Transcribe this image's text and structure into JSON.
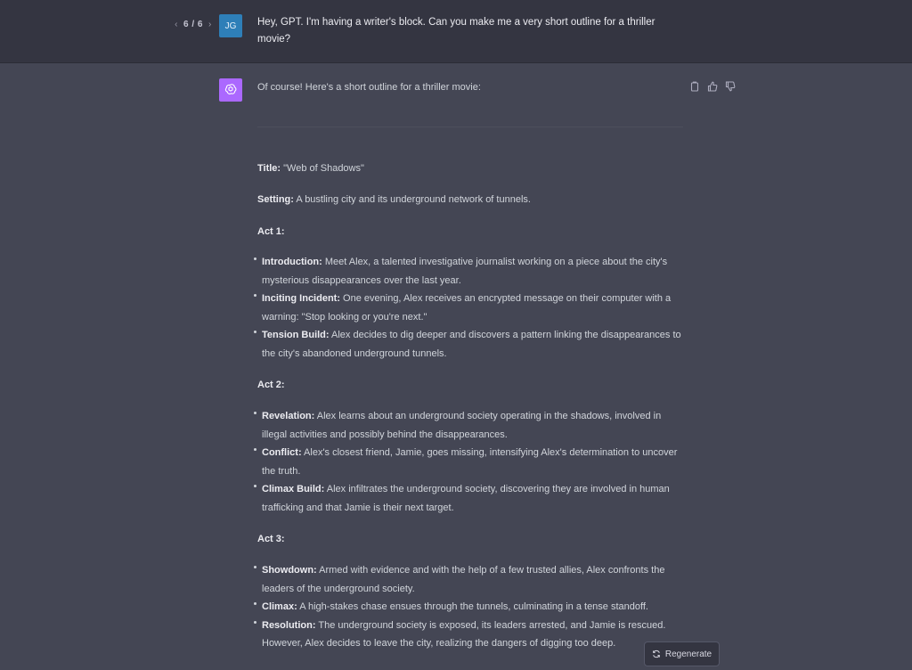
{
  "user_message": {
    "pager": {
      "prev_icon": "‹",
      "count": "6 / 6",
      "next_icon": "›"
    },
    "avatar": "JG",
    "text": "Hey, GPT. I'm having a writer's block. Can you make me a very short outline for a thriller movie?"
  },
  "assistant_message": {
    "intro": "Of course! Here's a short outline for a thriller movie:",
    "title": {
      "label": "Title:",
      "value": " \"Web of Shadows\""
    },
    "setting": {
      "label": "Setting:",
      "value": " A bustling city and its underground network of tunnels."
    },
    "acts": [
      {
        "heading": "Act 1:",
        "items": [
          {
            "label": "Introduction:",
            "text": " Meet Alex, a talented investigative journalist working on a piece about the city's mysterious disappearances over the last year."
          },
          {
            "label": "Inciting Incident:",
            "text": " One evening, Alex receives an encrypted message on their computer with a warning: \"Stop looking or you're next.\""
          },
          {
            "label": "Tension Build:",
            "text": " Alex decides to dig deeper and discovers a pattern linking the disappearances to the city's abandoned underground tunnels."
          }
        ]
      },
      {
        "heading": "Act 2:",
        "items": [
          {
            "label": "Revelation:",
            "text": " Alex learns about an underground society operating in the shadows, involved in illegal activities and possibly behind the disappearances."
          },
          {
            "label": "Conflict:",
            "text": " Alex's closest friend, Jamie, goes missing, intensifying Alex's determination to uncover the truth."
          },
          {
            "label": "Climax Build:",
            "text": " Alex infiltrates the underground society, discovering they are involved in human trafficking and that Jamie is their next target."
          }
        ]
      },
      {
        "heading": "Act 3:",
        "items": [
          {
            "label": "Showdown:",
            "text": " Armed with evidence and with the help of a few trusted allies, Alex confronts the leaders of the underground society."
          },
          {
            "label": "Climax:",
            "text": " A high-stakes chase ensues through the tunnels, culminating in a tense standoff."
          },
          {
            "label": "Resolution:",
            "text": " The underground society is exposed, its leaders arrested, and Jamie is rescued. However, Alex decides to leave the city, realizing the dangers of digging too deep."
          }
        ]
      }
    ]
  },
  "regenerate_button": {
    "label": "Regenerate",
    "icon": "refresh-icon"
  },
  "colors": {
    "user_bg": "#343541",
    "assistant_bg": "#444654",
    "gpt_avatar": "#ab68ff",
    "user_avatar": "#2e7fb8"
  }
}
